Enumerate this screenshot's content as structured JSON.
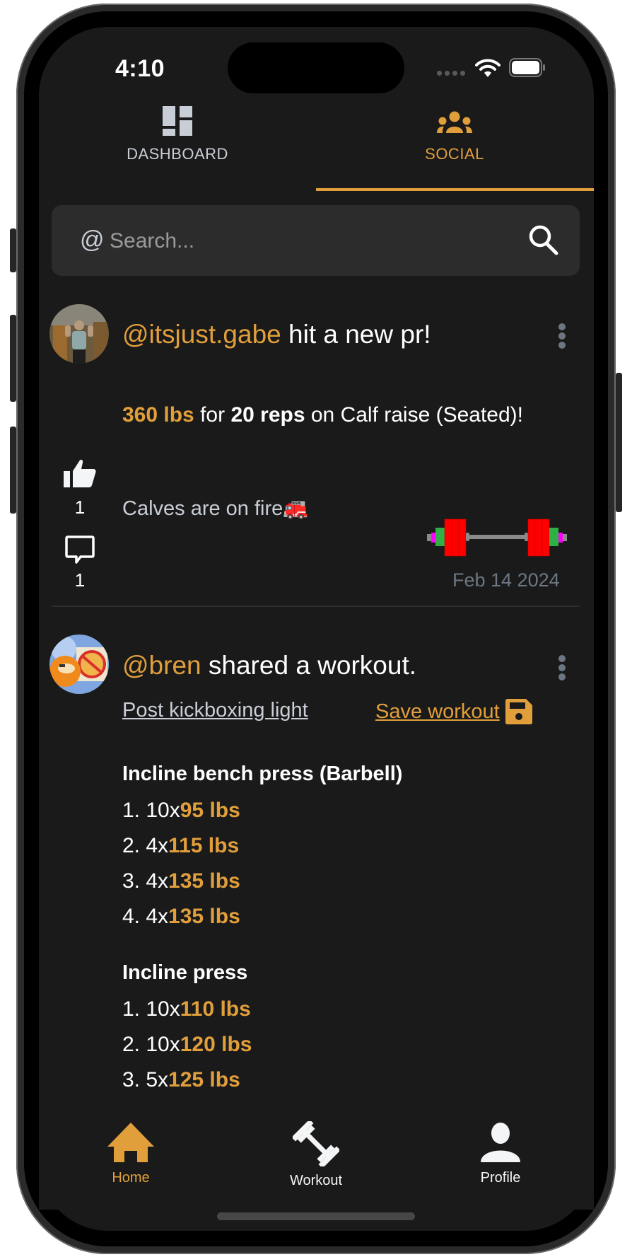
{
  "status_bar": {
    "time": "4:10"
  },
  "top_tabs": [
    {
      "label": "DASHBOARD",
      "icon": "dashboard-icon",
      "active": false
    },
    {
      "label": "SOCIAL",
      "icon": "group-icon",
      "active": true
    }
  ],
  "search": {
    "prefix": "@",
    "placeholder": "Search...",
    "value": ""
  },
  "colors": {
    "accent": "#e19f3b",
    "background": "#1a1a1a",
    "muted": "#6c7782"
  },
  "feed": [
    {
      "type": "pr",
      "username": "@itsjust.gabe",
      "action": "hit a new pr!",
      "weight": "360 lbs",
      "connector1": "for",
      "reps": "20 reps",
      "connector2": "on Calf raise (Seated)!",
      "caption": "Calves are on fire🚒",
      "likes": "1",
      "comments": "1",
      "date": "Feb 14 2024",
      "barbell_plates_per_side": [
        "red",
        "red",
        "red",
        "green",
        "magenta"
      ]
    },
    {
      "type": "workout",
      "username": "@bren",
      "action": "shared a workout.",
      "workout_name": "Post kickboxing light",
      "save_label": "Save workout",
      "exercises": [
        {
          "name": "Incline bench press (Barbell)",
          "sets": [
            {
              "prefix": "1. 10x",
              "weight": "95 lbs"
            },
            {
              "prefix": "2. 4x",
              "weight": "115 lbs"
            },
            {
              "prefix": "3. 4x",
              "weight": "135 lbs"
            },
            {
              "prefix": "4. 4x",
              "weight": "135 lbs"
            }
          ]
        },
        {
          "name": "Incline press",
          "sets": [
            {
              "prefix": "1. 10x",
              "weight": "110 lbs"
            },
            {
              "prefix": "2. 10x",
              "weight": "120 lbs"
            },
            {
              "prefix": "3. 5x",
              "weight": "125 lbs"
            }
          ]
        }
      ]
    }
  ],
  "bottom_nav": [
    {
      "label": "Home",
      "icon": "home-icon",
      "active": true
    },
    {
      "label": "Workout",
      "icon": "dumbbell-icon",
      "active": false
    },
    {
      "label": "Profile",
      "icon": "person-icon",
      "active": false
    }
  ]
}
